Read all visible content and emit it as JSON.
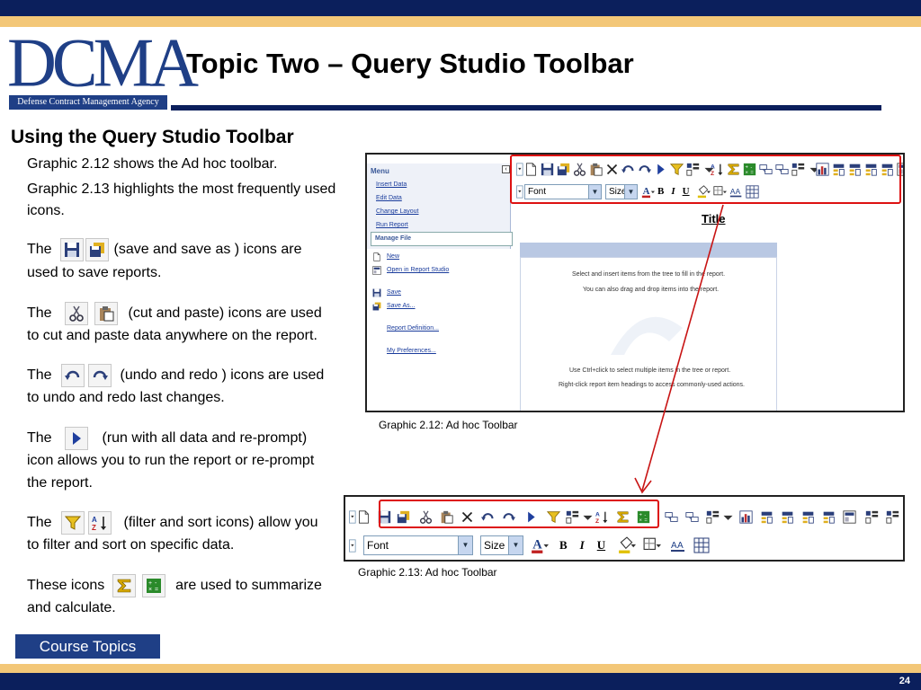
{
  "header": {
    "logo_text": "DCMA",
    "logo_subtitle": "Defense Contract Management Agency",
    "title": "Topic Two – Query Studio Toolbar"
  },
  "section": {
    "heading": "Using the Query Studio Toolbar",
    "para1": "Graphic 2.12 shows the Ad hoc  toolbar.",
    "para2_line1": "Graphic 2.13 highlights the most frequently used",
    "para2_line2": "icons."
  },
  "icon_descriptions": {
    "save": {
      "lead": "The",
      "text1": "(save and save as ) icons are",
      "text2": "used to save reports."
    },
    "cut": {
      "lead": "The",
      "text1": "(cut and paste) icons are used",
      "text2": "to cut and paste data anywhere on the report."
    },
    "undo": {
      "lead": "The",
      "text1": "(undo and redo ) icons are used",
      "text2": "to undo and redo last changes."
    },
    "run": {
      "lead": "The",
      "text1": "(run with all data and re-prompt)",
      "text2": "icon allows you to run the report or re-prompt",
      "text3": "the report."
    },
    "filter": {
      "lead": "The",
      "text1": "(filter and sort icons) allow you",
      "text2": "to filter and sort on specific data."
    },
    "summarize": {
      "lead": "These icons",
      "text1": "are used to summarize",
      "text2": "and calculate."
    }
  },
  "graphic_212": {
    "caption": "Graphic 2.12: Ad hoc Toolbar",
    "menu_title": "Menu",
    "menu_items": [
      "Insert Data",
      "Edit Data",
      "Change Layout",
      "Run Report"
    ],
    "manage_file": "Manage File",
    "file_items": [
      "New",
      "Open in Report Studio",
      "Save",
      "Save As...",
      "Report Definition...",
      "My Preferences..."
    ],
    "font_value": "Font",
    "size_value": "Size",
    "report_title": "Title",
    "msg1": "Select and insert items from the tree to fill in the report.",
    "msg2": "You can also drag and drop items into the report.",
    "msg3": "Use Ctrl+click to select multiple items in the tree or report.",
    "msg4": "Right-click report item headings to access commonly-used actions."
  },
  "graphic_213": {
    "caption": "Graphic 2.13: Ad hoc Toolbar",
    "font_value": "Font",
    "size_value": "Size"
  },
  "format_buttons": {
    "bold": "B",
    "italic": "I",
    "underline": "U",
    "font_a": "A"
  },
  "nav": {
    "course_topics": "Course Topics"
  },
  "footer": {
    "page_number": "24"
  },
  "colors": {
    "navy": "#0b1f5c",
    "gold": "#f3c778",
    "brand_blue": "#1f3f86",
    "highlight_red": "#d11111"
  }
}
